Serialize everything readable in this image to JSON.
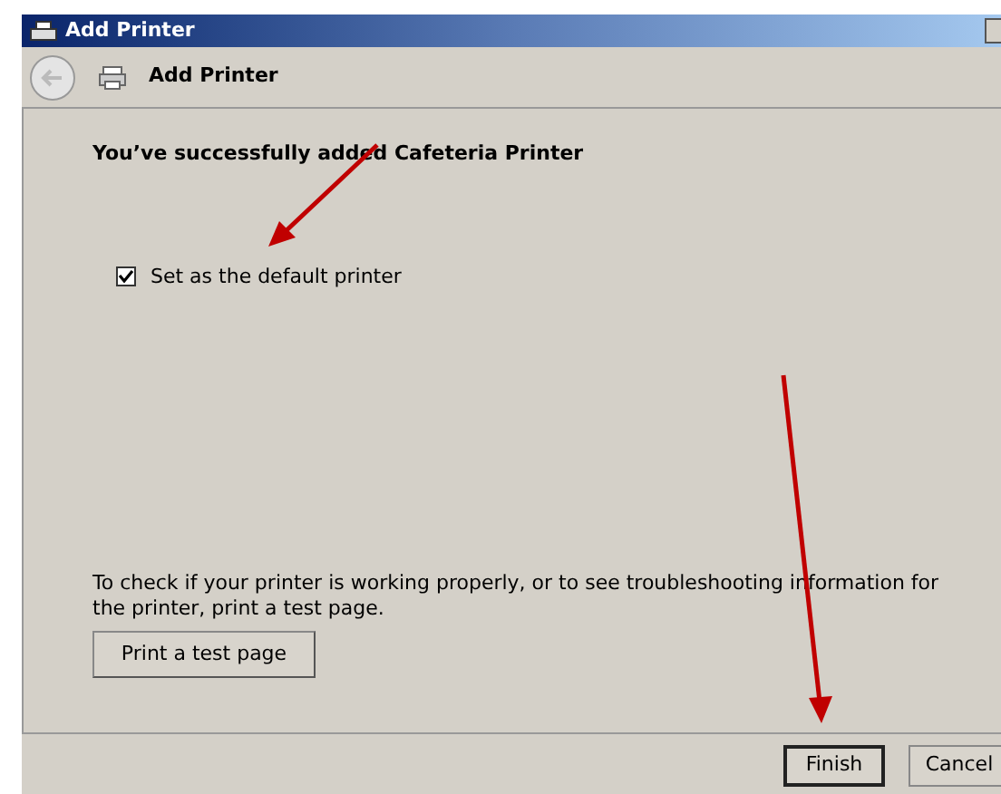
{
  "window": {
    "title": "Add Printer"
  },
  "header": {
    "title": "Add Printer"
  },
  "content": {
    "heading": "You’ve successfully added Cafeteria Printer",
    "default_checkbox": {
      "label": "Set as the default printer",
      "checked": true
    },
    "info": "To check if your printer is working properly, or to see troubleshooting information for the printer, print a test page.",
    "test_button": "Print a test page"
  },
  "buttons": [
    {
      "label": "Finish",
      "selected": true
    },
    {
      "label": "Cancel",
      "selected": false
    }
  ]
}
